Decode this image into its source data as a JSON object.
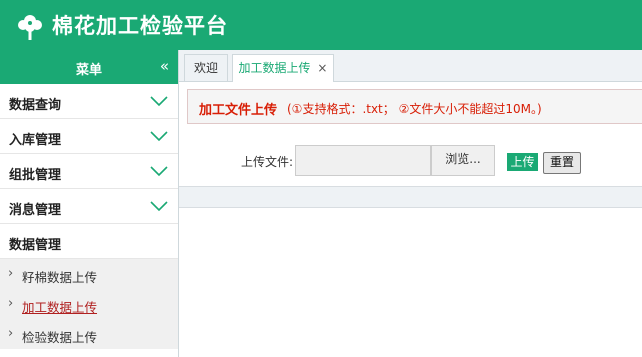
{
  "header": {
    "app_title": "棉花加工检验平台",
    "logo_icon": "cotton-leaf-icon",
    "brand_color": "#1aa974"
  },
  "sidebar": {
    "menu_title": "菜单",
    "collapse_icon": "double-chevron-left-icon",
    "items": [
      {
        "label": "数据查询"
      },
      {
        "label": "入库管理"
      },
      {
        "label": "组批管理"
      },
      {
        "label": "消息管理"
      },
      {
        "label": "数据管理"
      }
    ],
    "subitems": [
      {
        "label": "籽棉数据上传"
      },
      {
        "label": "加工数据上传"
      },
      {
        "label": "检验数据上传"
      }
    ]
  },
  "tabs": [
    {
      "label": "欢迎"
    },
    {
      "label": "加工数据上传",
      "close": "×"
    }
  ],
  "notice": {
    "title": "加工文件上传",
    "desc": "(①支持格式：.txt； ②文件大小不能超过10M。)",
    "color": "#d81e06"
  },
  "form": {
    "file_label": "上传文件:",
    "browse_label": "浏览...",
    "upload_label": "上传",
    "reset_label": "重置"
  }
}
